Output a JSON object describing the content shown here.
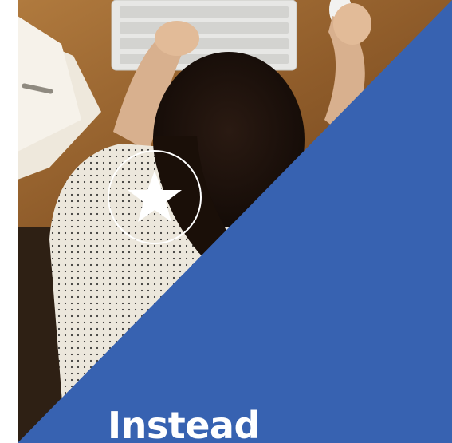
{
  "hero": {
    "headline": "Instead",
    "badge_icon": "star-icon",
    "colors": {
      "accent_blue": "#3762b1",
      "badge_white": "#ffffff"
    }
  }
}
